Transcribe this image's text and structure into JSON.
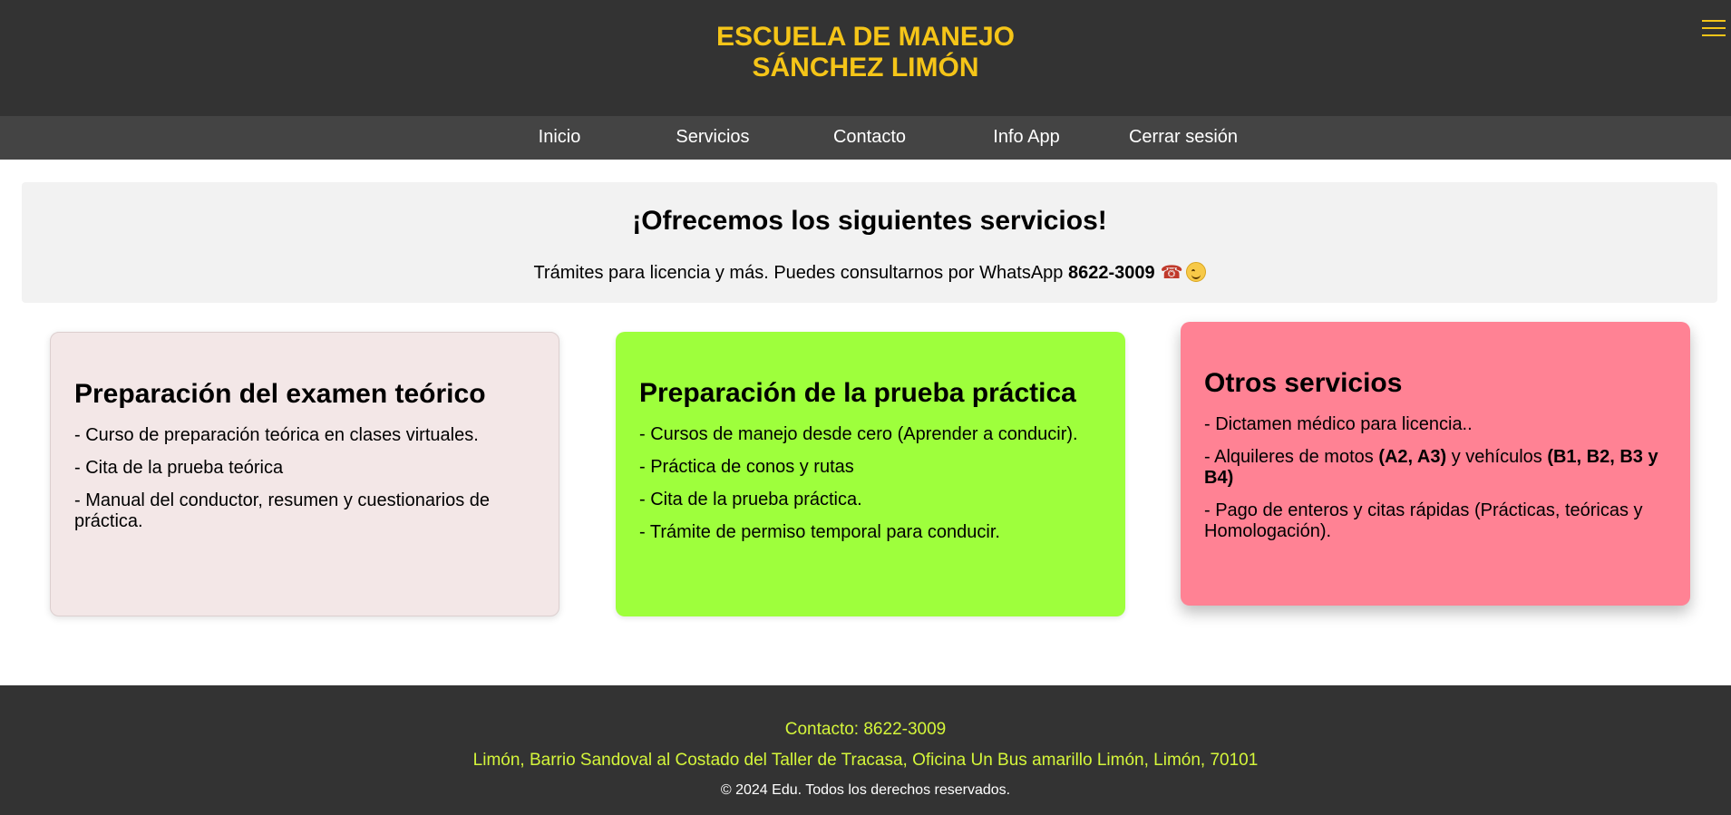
{
  "header": {
    "title_line1": "ESCUELA DE MANEJO",
    "title_line2": "SÁNCHEZ LIMÓN",
    "menu_icon": "hamburger-menu-icon",
    "title_color": "#f5c518"
  },
  "nav": {
    "items": [
      {
        "label": "Inicio"
      },
      {
        "label": "Servicios"
      },
      {
        "label": "Contacto"
      },
      {
        "label": "Info App"
      },
      {
        "label": "Cerrar sesión"
      }
    ]
  },
  "hero": {
    "title": "¡Ofrecemos los siguientes servicios!",
    "text": "Trámites para licencia y más. Puedes consultarnos por WhatsApp ",
    "phone": "8622-3009",
    "icons": [
      "telephone-receiver-icon",
      "smiling-face-icon"
    ]
  },
  "cards": [
    {
      "title": "Preparación del examen teórico",
      "color": "#f3e7e7",
      "items": [
        "- Curso de preparación teórica en clases virtuales.",
        "- Cita de la prueba teórica",
        "- Manual del conductor, resumen y cuestionarios de práctica."
      ]
    },
    {
      "title": "Preparación de la prueba práctica",
      "color": "#9eff3c",
      "items": [
        "- Cursos de manejo desde cero (Aprender a conducir).",
        "- Práctica de conos y rutas",
        "- Cita de la prueba práctica.",
        "- Trámite de permiso temporal para conducir."
      ]
    },
    {
      "title": "Otros servicios",
      "color": "#ff8294",
      "items": [
        "- Dictamen médico para licencia..",
        {
          "prefix": "- Alquileres de motos ",
          "bold1": "(A2, A3)",
          "middle": " y vehículos ",
          "bold2": "(B1, B2, B3 y B4)"
        },
        "- Pago de enteros y citas rápidas (Prácticas, teóricas y Homologación)."
      ]
    }
  ],
  "footer": {
    "contact": "Contacto: 8622-3009",
    "address": "Limón, Barrio Sandoval al Costado del Taller de Tracasa, Oficina Un Bus amarillo Limón, Limón, 70101",
    "copyright": "© 2024 Edu. Todos los derechos reservados.",
    "accent_color": "#d4f53a"
  }
}
